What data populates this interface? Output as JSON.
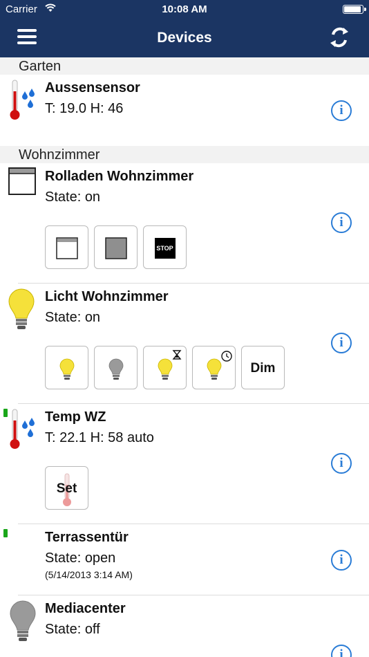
{
  "status": {
    "carrier": "Carrier",
    "time": "10:08 AM",
    "battery_level": 0.9
  },
  "nav": {
    "title": "Devices"
  },
  "sections": {
    "garten": {
      "title": "Garten"
    },
    "wohnzimmer": {
      "title": "Wohnzimmer"
    }
  },
  "devices": {
    "aussensensor": {
      "name": "Aussensensor",
      "state": "T: 19.0 H: 46"
    },
    "rolladen": {
      "name": "Rolladen Wohnzimmer",
      "state": "State: on",
      "stop_label": "STOP"
    },
    "licht": {
      "name": "Licht Wohnzimmer",
      "state": "State: on",
      "dim_label": "Dim"
    },
    "tempwz": {
      "name": "Temp WZ",
      "state": "T: 22.1 H: 58 auto",
      "set_label": "Set"
    },
    "terrasse": {
      "name": "Terrassentür",
      "state": "State: open",
      "timestamp": "(5/14/2013 3:14 AM)"
    },
    "mediacenter": {
      "name": "Mediacenter",
      "state": "State: off"
    }
  },
  "info_glyph": "i",
  "colors": {
    "navbar": "#1b3563",
    "info": "#2a7cd6",
    "battery_ok": "#1aa61a",
    "bulb_on": "#f5e13a",
    "bulb_off": "#9a9a9a",
    "thermo_red": "#d01010",
    "drops": "#1f6fd6"
  }
}
